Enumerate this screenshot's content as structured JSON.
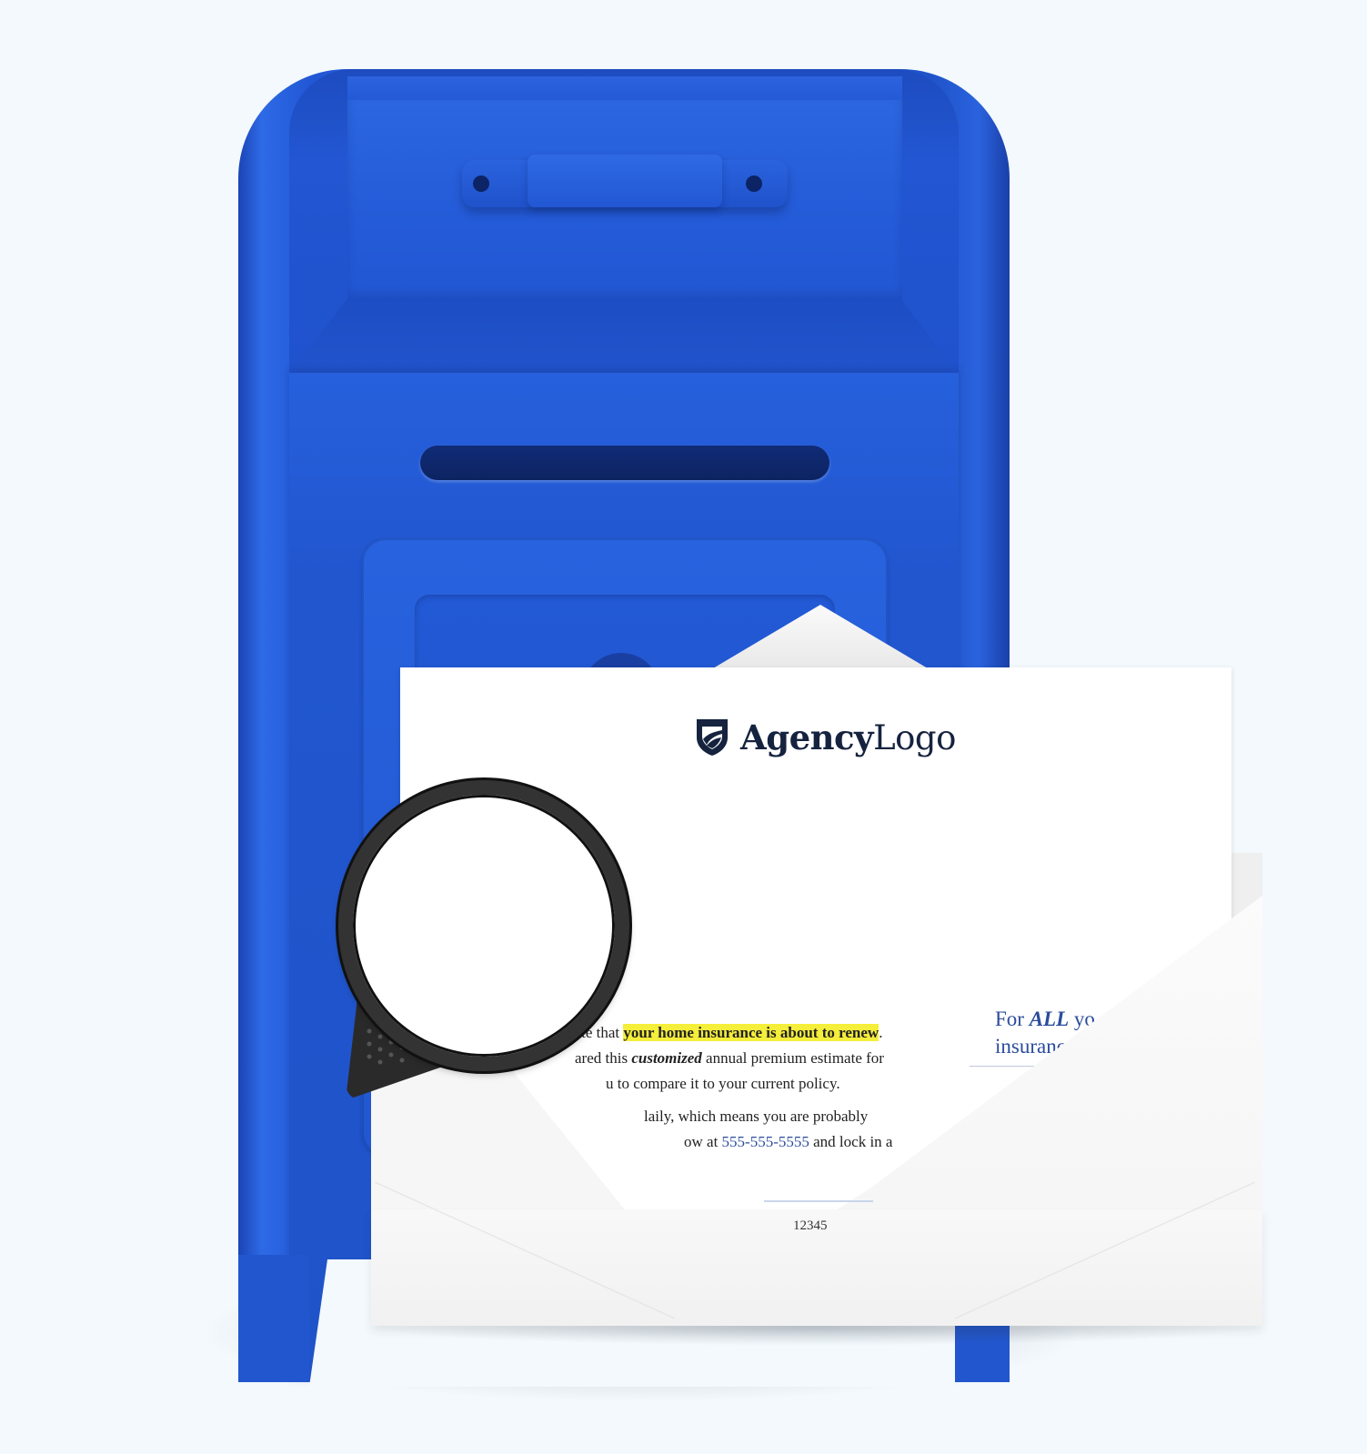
{
  "colors": {
    "background": "#f3f9fc",
    "mailbox_blue": "#2156cf",
    "mailbox_dark": "#0d2462",
    "logo_navy": "#15233f",
    "highlight": "#f5ee3a",
    "link_blue": "#2b4c9b"
  },
  "icons": {
    "mailbox": "mailbox-icon",
    "shield": "shield-icon",
    "magnifier": "magnifier-icon"
  },
  "letter": {
    "logo": {
      "bold": "Agency",
      "regular": "Logo"
    },
    "para1": {
      "line1_pre": "cate that ",
      "line1_highlight": "your home insurance is about to renew",
      "line1_post": ".",
      "line2_pre": "ared this ",
      "line2_emphasis": "customized",
      "line2_post": " annual premium estimate for",
      "line3": "u to compare it to your current policy."
    },
    "para2": {
      "line1": "laily,  which  means  you  are  probably",
      "line2_pre": "ow at ",
      "line2_phone": "555-555-5555",
      "line2_post": "  and lock in a"
    },
    "side": {
      "line1_pre": "For ",
      "line1_emphasis": "ALL",
      "line1_post": " yo",
      "line2": "insuranc"
    },
    "zip": "12345"
  }
}
